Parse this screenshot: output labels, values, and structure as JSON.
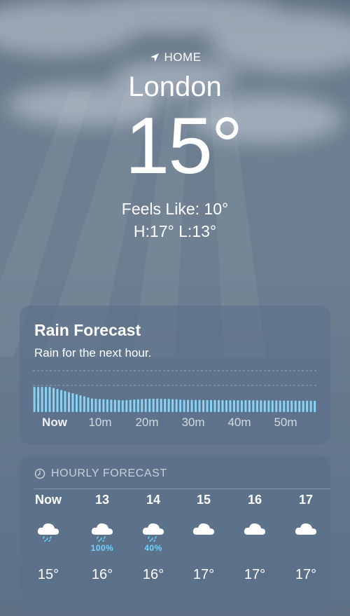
{
  "location": {
    "label": "HOME",
    "city": "London"
  },
  "current": {
    "temperature": "15°",
    "feels_like": "Feels Like: 10°",
    "high_low": "H:17°  L:13°"
  },
  "rain_forecast": {
    "title": "Rain Forecast",
    "subtitle": "Rain for the next hour.",
    "time_labels": [
      "Now",
      "10m",
      "20m",
      "30m",
      "40m",
      "50m"
    ]
  },
  "hourly_forecast": {
    "heading": "HOURLY FORECAST",
    "hours": [
      {
        "time": "Now",
        "icon": "cloud-rain-icon",
        "precip": "",
        "temp": "15°"
      },
      {
        "time": "13",
        "icon": "cloud-rain-icon",
        "precip": "100%",
        "temp": "16°"
      },
      {
        "time": "14",
        "icon": "cloud-rain-icon",
        "precip": "40%",
        "temp": "16°"
      },
      {
        "time": "15",
        "icon": "cloud-icon",
        "precip": "",
        "temp": "17°"
      },
      {
        "time": "16",
        "icon": "cloud-icon",
        "precip": "",
        "temp": "17°"
      },
      {
        "time": "17",
        "icon": "cloud-icon",
        "precip": "",
        "temp": "17°"
      }
    ]
  },
  "colors": {
    "rain_bar": "#86d3f5",
    "precip_text": "#6ed3ff"
  }
}
